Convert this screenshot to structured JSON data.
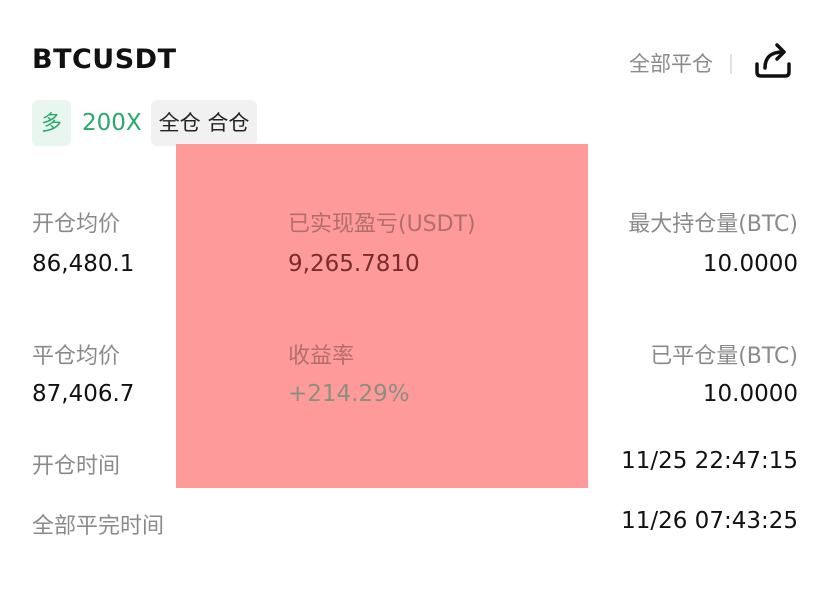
{
  "header": {
    "symbol": "BTCUSDT",
    "close_all_label": "全部平仓",
    "share_icon": "share-icon"
  },
  "tags": {
    "side": "多",
    "leverage": "200X",
    "margin_mode": "全仓 合仓"
  },
  "colors": {
    "accent_green": "#2aa86b",
    "redaction": "#ff9a9a",
    "label_gray": "#8a8a8a"
  },
  "fields": {
    "avg_open_price_label": "开仓均价",
    "avg_open_price_value": "86,480.1",
    "realized_pnl_label": "已实现盈亏(USDT)",
    "realized_pnl_value": "9,265.7810",
    "max_position_label": "最大持仓量(BTC)",
    "max_position_value": "10.0000",
    "avg_close_price_label": "平仓均价",
    "avg_close_price_value": "87,406.7",
    "roi_label": "收益率",
    "roi_value": "+214.29%",
    "closed_amount_label": "已平仓量(BTC)",
    "closed_amount_value": "10.0000",
    "open_time_label": "开仓时间",
    "open_time_value": "11/25 22:47:15",
    "full_close_time_label": "全部平完时间",
    "full_close_time_value": "11/26 07:43:25"
  }
}
